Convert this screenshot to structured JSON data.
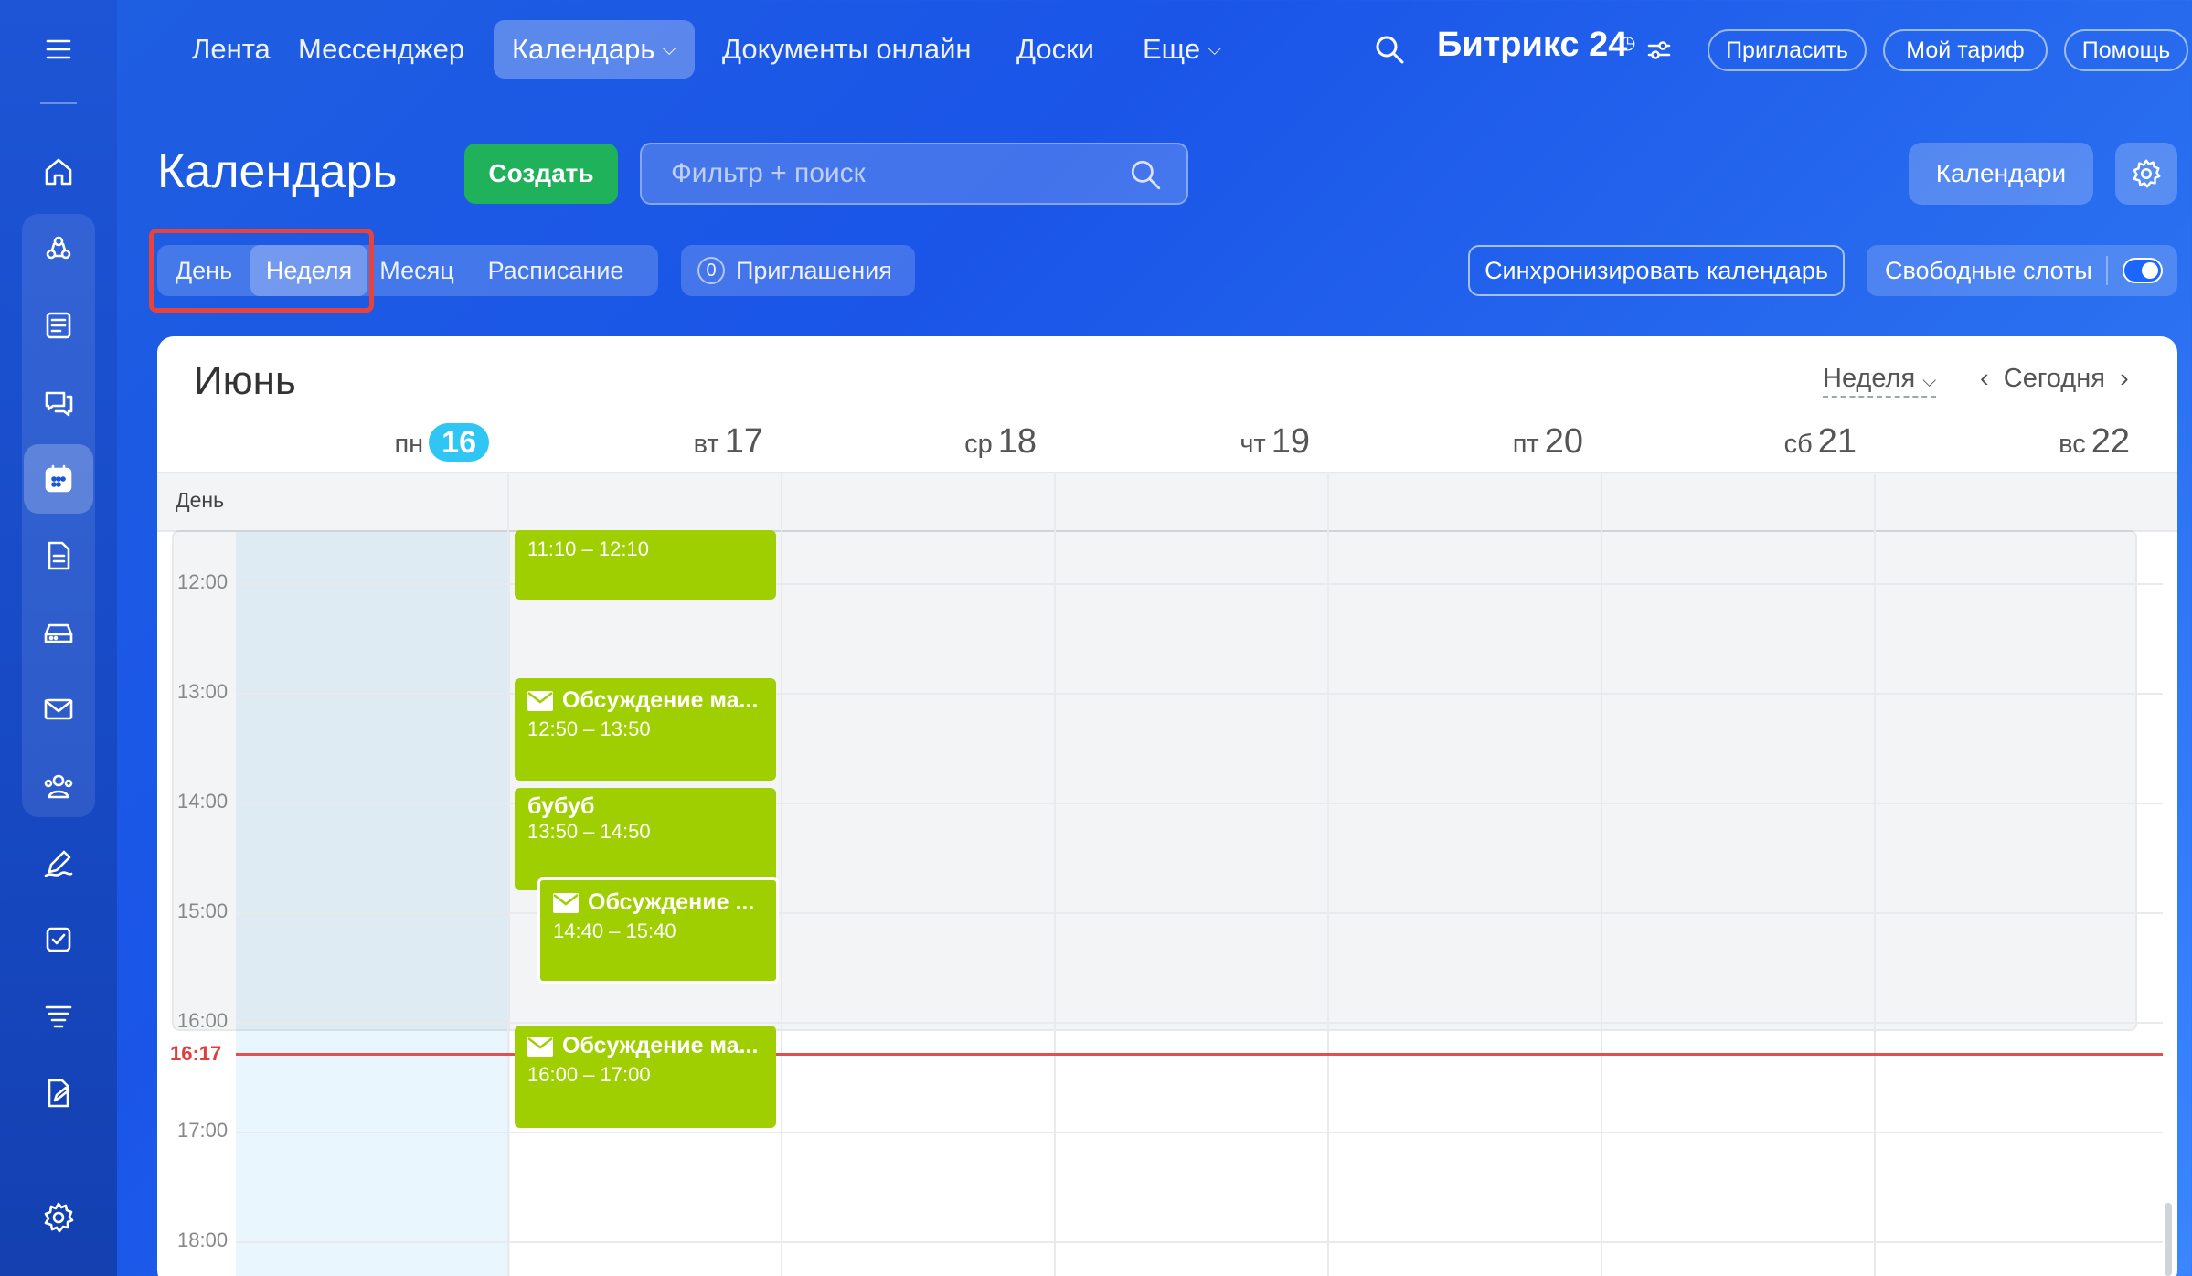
{
  "topnav": {
    "items": [
      {
        "label": "Лента"
      },
      {
        "label": "Мессенджер"
      },
      {
        "label": "Календарь"
      },
      {
        "label": "Документы онлайн"
      },
      {
        "label": "Доски"
      },
      {
        "label": "Еще"
      }
    ],
    "brand": "Битрикс 24",
    "invite": "Пригласить",
    "tariff": "Мой тариф",
    "help": "Помощь"
  },
  "header": {
    "title": "Календарь",
    "create": "Создать",
    "search_placeholder": "Фильтр + поиск",
    "calendars": "Календари"
  },
  "views": {
    "day": "День",
    "week": "Неделя",
    "month": "Месяц",
    "schedule": "Расписание",
    "invites_count": "0",
    "invites_label": "Приглашения",
    "sync": "Синхронизировать календарь",
    "free_slots": "Свободные слоты"
  },
  "calendar": {
    "month": "Июнь",
    "view_select": "Неделя",
    "today": "Сегодня",
    "allday_label": "День",
    "days": [
      {
        "dow": "пн",
        "num": "16"
      },
      {
        "dow": "вт",
        "num": "17"
      },
      {
        "dow": "ср",
        "num": "18"
      },
      {
        "dow": "чт",
        "num": "19"
      },
      {
        "dow": "пт",
        "num": "20"
      },
      {
        "dow": "сб",
        "num": "21"
      },
      {
        "dow": "вс",
        "num": "22"
      }
    ],
    "hours": [
      "12:00",
      "13:00",
      "14:00",
      "15:00",
      "16:00",
      "17:00",
      "18:00"
    ],
    "now": "16:17",
    "events": [
      {
        "title": "",
        "time": "11:10 – 12:10",
        "mail": false
      },
      {
        "title": "Обсуждение ма...",
        "time": "12:50 – 13:50",
        "mail": true
      },
      {
        "title": "бубуб",
        "time": "13:50 – 14:50",
        "mail": false
      },
      {
        "title": "Обсуждение ...",
        "time": "14:40 – 15:40",
        "mail": true
      },
      {
        "title": "Обсуждение ма...",
        "time": "16:00 – 17:00",
        "mail": true
      }
    ]
  }
}
